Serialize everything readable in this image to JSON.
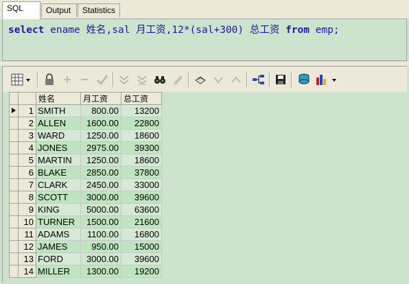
{
  "tabs": [
    {
      "label": "SQL"
    },
    {
      "label": "Output"
    },
    {
      "label": "Statistics"
    }
  ],
  "editor": {
    "kw_select": "select",
    "mid1": " ename 姓名,sal 月工资,12*(sal+300) 总工资 ",
    "kw_from": "from",
    "tail": " emp;"
  },
  "toolbar_icons": [
    "grid-menu-icon",
    "lock-icon",
    "add-record-icon",
    "delete-record-icon",
    "post-check-icon",
    "filter-icon",
    "clear-filter-icon",
    "find-binoculars-icon",
    "clear-icon",
    "print-icon",
    "down-arrow-icon",
    "up-arrow-icon",
    "query-plan-icon",
    "save-icon",
    "export-icon",
    "chart-icon"
  ],
  "grid": {
    "columns": [
      "姓名",
      "月工资",
      "总工资"
    ],
    "rows": [
      {
        "n": "1",
        "name": "SMITH",
        "sal": "800.00",
        "tot": "13200"
      },
      {
        "n": "2",
        "name": "ALLEN",
        "sal": "1600.00",
        "tot": "22800"
      },
      {
        "n": "3",
        "name": "WARD",
        "sal": "1250.00",
        "tot": "18600"
      },
      {
        "n": "4",
        "name": "JONES",
        "sal": "2975.00",
        "tot": "39300"
      },
      {
        "n": "5",
        "name": "MARTIN",
        "sal": "1250.00",
        "tot": "18600"
      },
      {
        "n": "6",
        "name": "BLAKE",
        "sal": "2850.00",
        "tot": "37800"
      },
      {
        "n": "7",
        "name": "CLARK",
        "sal": "2450.00",
        "tot": "33000"
      },
      {
        "n": "8",
        "name": "SCOTT",
        "sal": "3000.00",
        "tot": "39600"
      },
      {
        "n": "9",
        "name": "KING",
        "sal": "5000.00",
        "tot": "63600"
      },
      {
        "n": "10",
        "name": "TURNER",
        "sal": "1500.00",
        "tot": "21600"
      },
      {
        "n": "11",
        "name": "ADAMS",
        "sal": "1100.00",
        "tot": "16800"
      },
      {
        "n": "12",
        "name": "JAMES",
        "sal": "950.00",
        "tot": "15000"
      },
      {
        "n": "13",
        "name": "FORD",
        "sal": "3000.00",
        "tot": "39600"
      },
      {
        "n": "14",
        "name": "MILLER",
        "sal": "1300.00",
        "tot": "19200"
      }
    ]
  }
}
